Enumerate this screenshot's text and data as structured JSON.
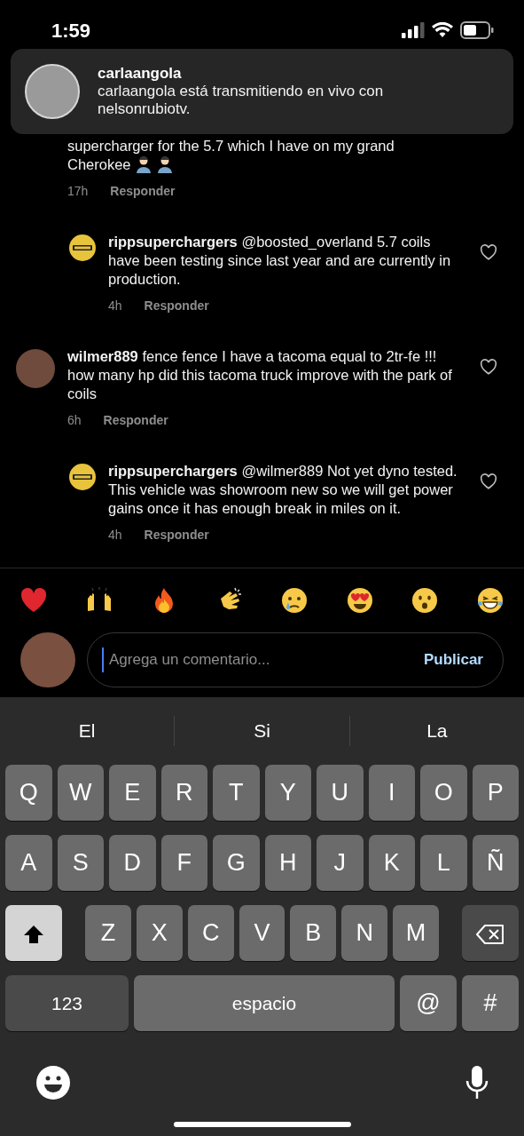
{
  "status_bar": {
    "time": "1:59"
  },
  "notification": {
    "title": "carlaangola",
    "message": "carlaangola está transmitiendo en vivo con nelsonrubiotv."
  },
  "comments": [
    {
      "kind": "partial",
      "text": "supercharger for the 5.7 which I have on my grand Cherokee",
      "time": "17h",
      "reply_label": "Responder"
    },
    {
      "kind": "reply",
      "username": "rippsuperchargers",
      "text": "@boosted_overland 5.7 coils have been testing since last year and are currently in production.",
      "time": "4h",
      "reply_label": "Responder",
      "liked": false
    },
    {
      "kind": "main",
      "username": "wilmer889",
      "text": "fence fence I have a tacoma equal to 2tr-fe !!! how many hp did this tacoma truck improve with the park of coils",
      "time": "6h",
      "reply_label": "Responder",
      "liked": false
    },
    {
      "kind": "reply",
      "username": "rippsuperchargers",
      "text": "@wilmer889 Not yet dyno tested.  This vehicle was showroom new so we will get power gains once it has enough break in miles on it.",
      "time": "4h",
      "reply_label": "Responder",
      "liked": false
    }
  ],
  "composer": {
    "placeholder": "Agrega un comentario...",
    "button": "Publicar"
  },
  "keyboard": {
    "suggestions": [
      "El",
      "Si",
      "La"
    ],
    "rows": [
      [
        "Q",
        "W",
        "E",
        "R",
        "T",
        "Y",
        "U",
        "I",
        "O",
        "P"
      ],
      [
        "A",
        "S",
        "D",
        "F",
        "G",
        "H",
        "J",
        "K",
        "L",
        "Ñ"
      ],
      [
        "Z",
        "X",
        "C",
        "V",
        "B",
        "N",
        "M"
      ]
    ],
    "numbers_key": "123",
    "space_key": "espacio",
    "at_key": "@",
    "hash_key": "#"
  }
}
